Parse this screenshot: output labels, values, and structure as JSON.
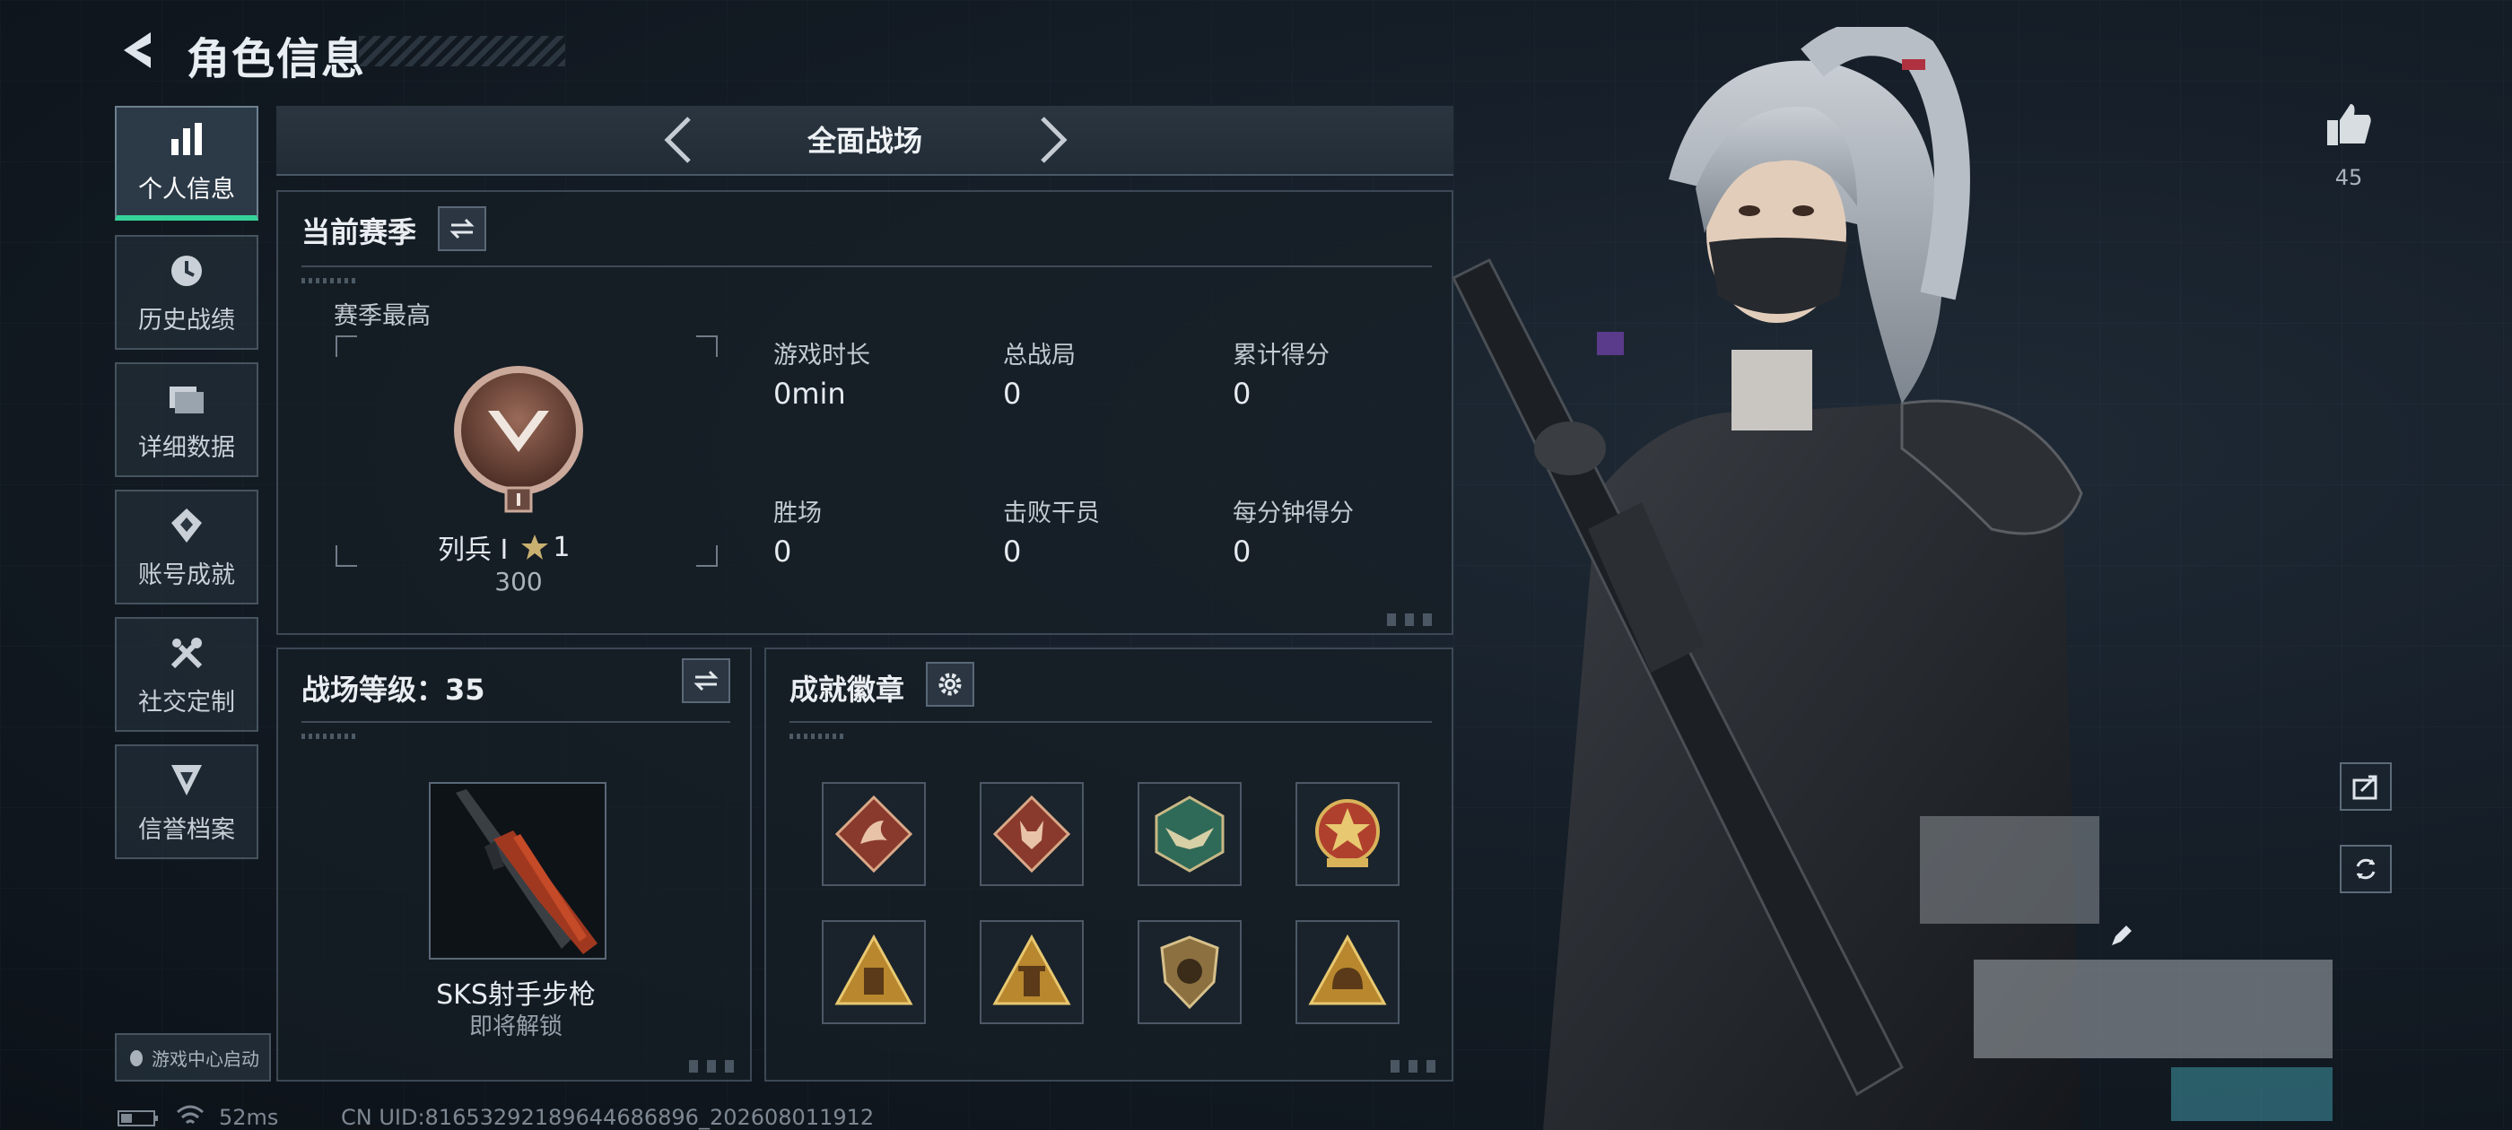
{
  "header": {
    "title": "角色信息"
  },
  "sidebar": {
    "items": [
      {
        "label": "个人信息",
        "icon": "bar-chart-icon",
        "active": true
      },
      {
        "label": "历史战绩",
        "icon": "clock-icon",
        "active": false
      },
      {
        "label": "详细数据",
        "icon": "folder-icon",
        "active": false
      },
      {
        "label": "账号成就",
        "icon": "medal-icon",
        "active": false
      },
      {
        "label": "社交定制",
        "icon": "tools-icon",
        "active": false
      },
      {
        "label": "信誉档案",
        "icon": "shield-icon",
        "active": false
      }
    ],
    "game_center": "游戏中心启动"
  },
  "mode": {
    "label": "全面战场"
  },
  "season": {
    "title": "当前赛季",
    "highest_label": "赛季最高",
    "rank_name": "列兵 Ⅰ",
    "rank_stars": "1",
    "rank_points": "300",
    "stats": [
      {
        "label": "游戏时长",
        "value": "0min"
      },
      {
        "label": "总战局",
        "value": "0"
      },
      {
        "label": "累计得分",
        "value": "0"
      },
      {
        "label": "胜场",
        "value": "0"
      },
      {
        "label": "击败干员",
        "value": "0"
      },
      {
        "label": "每分钟得分",
        "value": "0"
      }
    ]
  },
  "battlefield_level": {
    "title": "战场等级：35",
    "weapon_name": "SKS射手步枪",
    "weapon_status": "即将解锁"
  },
  "achievements": {
    "title": "成就徽章",
    "badges": [
      {
        "icon": "dragon-diamond-badge-icon",
        "color": "#8a3a2c"
      },
      {
        "icon": "wolf-diamond-badge-icon",
        "color": "#8a3a2c"
      },
      {
        "icon": "winged-hexagon-badge-icon",
        "color": "#2f6a58"
      },
      {
        "icon": "star-emblem-badge-icon",
        "color": "#b0402e"
      },
      {
        "icon": "triangle-scroll-badge-icon",
        "color": "#b8872e"
      },
      {
        "icon": "triangle-tower-badge-icon",
        "color": "#b8872e"
      },
      {
        "icon": "shield-badge-icon",
        "color": "#8c7040"
      },
      {
        "icon": "triangle-helmet-badge-icon",
        "color": "#b8872e"
      }
    ]
  },
  "social": {
    "likes": "45"
  },
  "status_bar": {
    "ping": "52ms",
    "uid": "CN UID:816532921896446868​96_202608011912"
  },
  "colors": {
    "accent": "#35d39a",
    "panel_border": "#3c4855",
    "background": "#131b24"
  }
}
